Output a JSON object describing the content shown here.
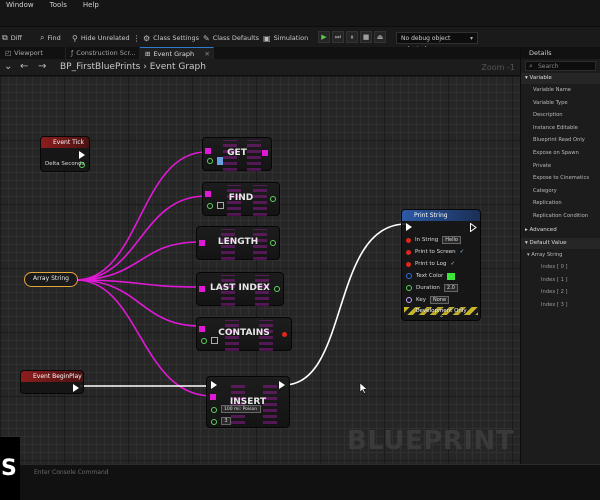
{
  "menu": [
    "Window",
    "Tools",
    "Help"
  ],
  "toolbar": {
    "diff": "Diff",
    "find": "Find",
    "hide_unrelated": "Hide Unrelated",
    "class_settings": "Class Settings",
    "class_defaults": "Class Defaults",
    "simulation": "Simulation",
    "debug_object": "No debug object selected"
  },
  "tabs": [
    {
      "label": "Viewport"
    },
    {
      "label": "Construction Scr..."
    },
    {
      "label": "Event Graph"
    }
  ],
  "breadcrumb": {
    "root": "BP_FirstBluePrints",
    "sep": "›",
    "leaf": "Event Graph"
  },
  "zoom_label": "Zoom -1",
  "watermark": "BLUEPRINT",
  "nodes": {
    "event_tick": {
      "title": "Event Tick",
      "pin": "Delta Seconds"
    },
    "array_var": {
      "label": "Array String"
    },
    "get": "GET",
    "find": "FIND",
    "length": "LENGTH",
    "last_index": "LAST INDEX",
    "contains": "CONTAINS",
    "insert": {
      "title": "INSERT",
      "value": "100 mi: Poison",
      "index": "3"
    },
    "begin_play": {
      "title": "Event BeginPlay"
    },
    "print_string": {
      "title": "Print String",
      "in_string_label": "In String",
      "in_string_value": "Hello",
      "print_screen": "Print to Screen",
      "print_log": "Print to Log",
      "text_color": "Text Color",
      "duration_label": "Duration",
      "duration_value": "2.0",
      "key_label": "Key",
      "key_value": "None",
      "dev_only": "Development Only",
      "text_color_hex": "#3ce43c"
    }
  },
  "details": {
    "title": "Details",
    "search_placeholder": "Search",
    "variable_section": "Variable",
    "variable_props": [
      "Variable Name",
      "Variable Type",
      "Description",
      "Instance Editable",
      "Blueprint Read Only",
      "Expose on Spawn",
      "Private",
      "Expose to Cinematics",
      "Category",
      "Replication",
      "Replication Condition"
    ],
    "advanced": "Advanced",
    "default_section": "Default Value",
    "array_label": "Array String",
    "indices": [
      "Index [ 0 ]",
      "Index [ 1 ]",
      "Index [ 2 ]",
      "Index [ 3 ]"
    ]
  },
  "bottom": {
    "cmd_placeholder": "Enter Console Command",
    "logo": "S"
  },
  "colors": {
    "array_wire": "#e019d6",
    "exec_wire": "#ffffff",
    "accent": "#2f7bd0"
  }
}
